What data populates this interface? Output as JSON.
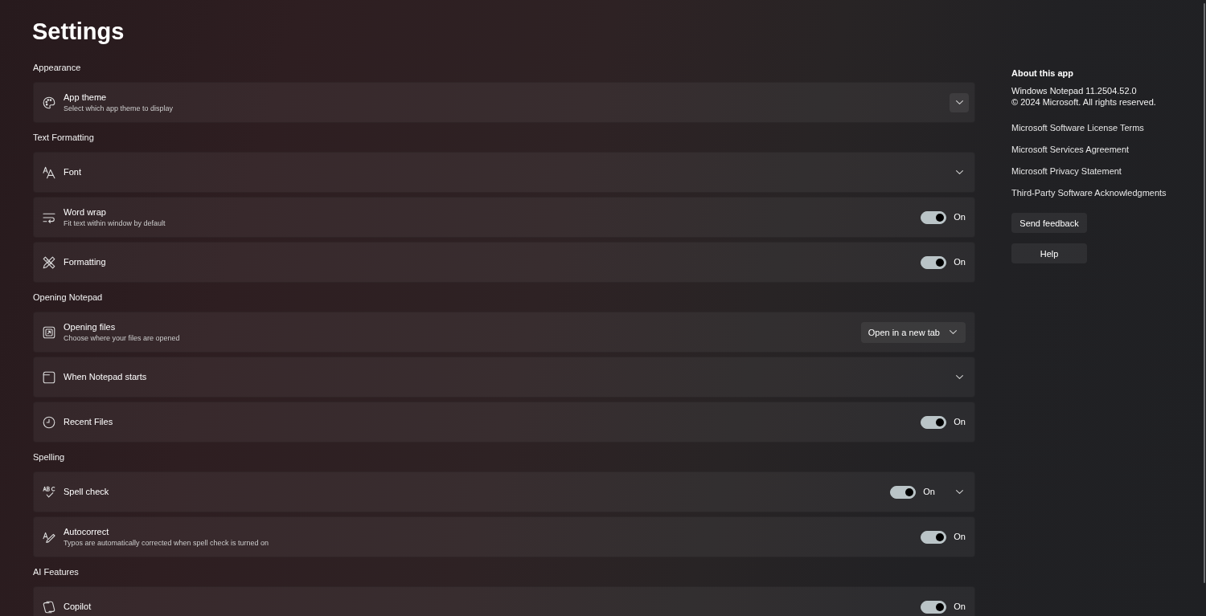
{
  "window": {
    "title": "Settings"
  },
  "sections": [
    {
      "heading": "Appearance",
      "items": [
        {
          "kind": "expander",
          "title": "App theme",
          "description": "Select which app theme to display",
          "hovered": true
        }
      ]
    },
    {
      "heading": "Text Formatting",
      "items": [
        {
          "kind": "expander",
          "title": "Font",
          "hovered": false
        },
        {
          "kind": "toggle",
          "title": "Word wrap",
          "description": "Fit text within window by default",
          "on": true,
          "state_label": "On"
        },
        {
          "kind": "toggle",
          "title": "Formatting",
          "on": true,
          "state_label": "On"
        }
      ]
    },
    {
      "heading": "Opening Notepad",
      "items": [
        {
          "kind": "select",
          "title": "Opening files",
          "description": "Choose where your files are opened",
          "value": "Open in a new tab"
        },
        {
          "kind": "expander",
          "title": "When Notepad starts",
          "hovered": false
        },
        {
          "kind": "toggle",
          "title": "Recent Files",
          "on": true,
          "state_label": "On"
        }
      ]
    },
    {
      "heading": "Spelling",
      "items": [
        {
          "kind": "toggle_expander",
          "title": "Spell check",
          "on": true,
          "state_label": "On"
        },
        {
          "kind": "toggle",
          "title": "Autocorrect",
          "description": "Typos are automatically corrected when spell check is turned on",
          "on": true,
          "state_label": "On"
        }
      ]
    },
    {
      "heading": "AI Features",
      "items": [
        {
          "kind": "toggle",
          "title": "Copilot",
          "on": true,
          "state_label": "On"
        }
      ]
    }
  ],
  "about": {
    "heading": "About this app",
    "version": "Windows Notepad 11.2504.52.0",
    "copyright": "© 2024 Microsoft. All rights reserved.",
    "links": [
      "Microsoft Software License Terms",
      "Microsoft Services Agreement",
      "Microsoft Privacy Statement",
      "Third-Party Software Acknowledgments"
    ],
    "buttons": [
      "Send feedback",
      "Help"
    ]
  }
}
